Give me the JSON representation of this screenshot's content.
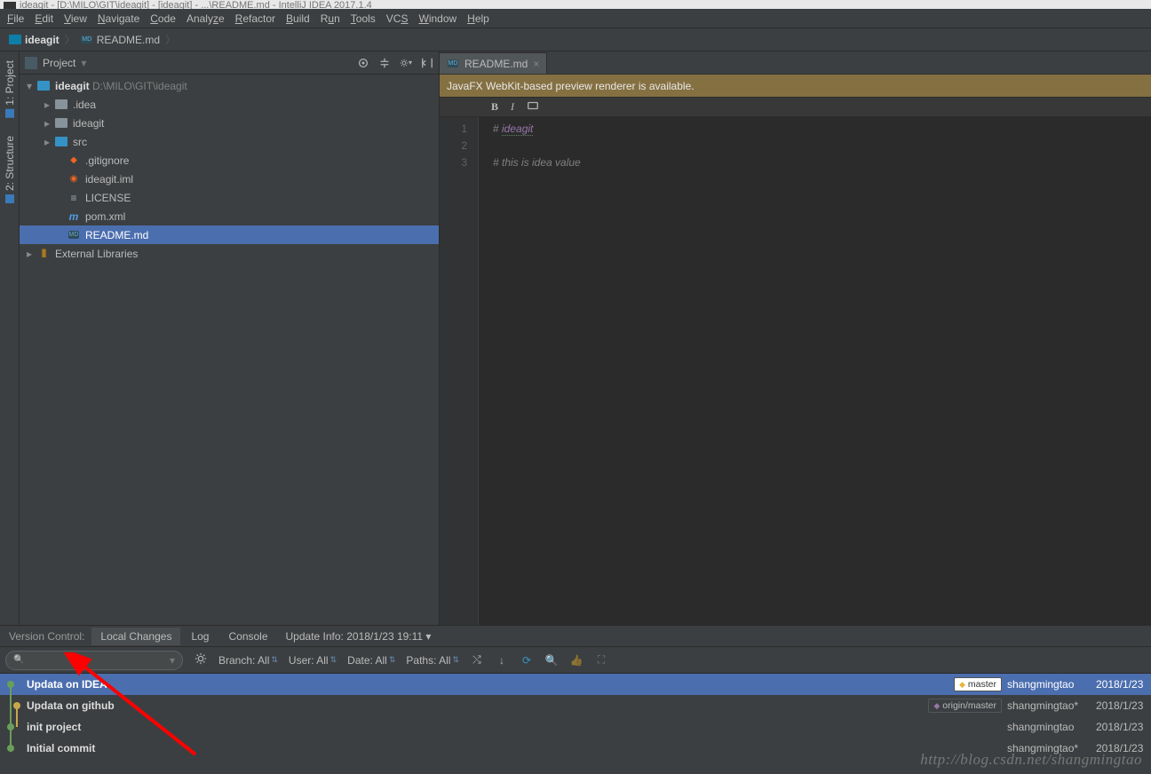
{
  "window": {
    "title_fragment": "ideagit - [D:\\MILO\\GIT\\ideagit] - [ideagit] - ...\\README.md - IntelliJ IDEA 2017.1.4"
  },
  "menu": [
    "File",
    "Edit",
    "View",
    "Navigate",
    "Code",
    "Analyze",
    "Refactor",
    "Build",
    "Run",
    "Tools",
    "VCS",
    "Window",
    "Help"
  ],
  "breadcrumb": {
    "root": "ideagit",
    "file": "README.md"
  },
  "sidebar_tabs": {
    "project": "1: Project",
    "structure": "2: Structure"
  },
  "project_panel": {
    "title": "Project",
    "root": {
      "name": "ideagit",
      "path": "D:\\MILO\\GIT\\ideagit"
    },
    "children": [
      {
        "label": ".idea",
        "type": "folder"
      },
      {
        "label": "ideagit",
        "type": "folder"
      },
      {
        "label": "src",
        "type": "folder-src"
      },
      {
        "label": ".gitignore",
        "type": "gitignore"
      },
      {
        "label": "ideagit.iml",
        "type": "iml"
      },
      {
        "label": "LICENSE",
        "type": "text"
      },
      {
        "label": "pom.xml",
        "type": "pom"
      },
      {
        "label": "README.md",
        "type": "md",
        "selected": true
      }
    ],
    "external_libs": "External Libraries"
  },
  "editor": {
    "tab": "README.md",
    "notification": "JavaFX WebKit-based preview renderer is available.",
    "toolbar": {
      "bold": "B",
      "italic": "I",
      "code": "⌨"
    },
    "lines": {
      "l1_prefix": "# ",
      "l1_text": "ideagit",
      "l3": "# this is idea value"
    }
  },
  "vcs_panel": {
    "label": "Version Control:",
    "tabs": [
      "Local Changes",
      "Log",
      "Console"
    ],
    "update_info": "Update Info: 2018/1/23 19:11",
    "filters": {
      "branch": "Branch: All",
      "user": "User: All",
      "date": "Date: All",
      "paths": "Paths: All"
    },
    "commits": [
      {
        "message": "Updata on IDEA",
        "tag": "master",
        "tag_type": "master",
        "author": "shangmingtao",
        "date": "2018/1/23",
        "selected": true,
        "dot": "g"
      },
      {
        "message": "Updata on github",
        "tag": "origin/master",
        "tag_type": "remote",
        "author": "shangmingtao*",
        "date": "2018/1/23",
        "dot": "y",
        "merge": true
      },
      {
        "message": "init project",
        "author": "shangmingtao",
        "date": "2018/1/23",
        "dot": "g"
      },
      {
        "message": "Initial commit",
        "author": "shangmingtao*",
        "date": "2018/1/23",
        "dot": "g"
      }
    ]
  },
  "watermark": "http://blog.csdn.net/shangmingtao"
}
